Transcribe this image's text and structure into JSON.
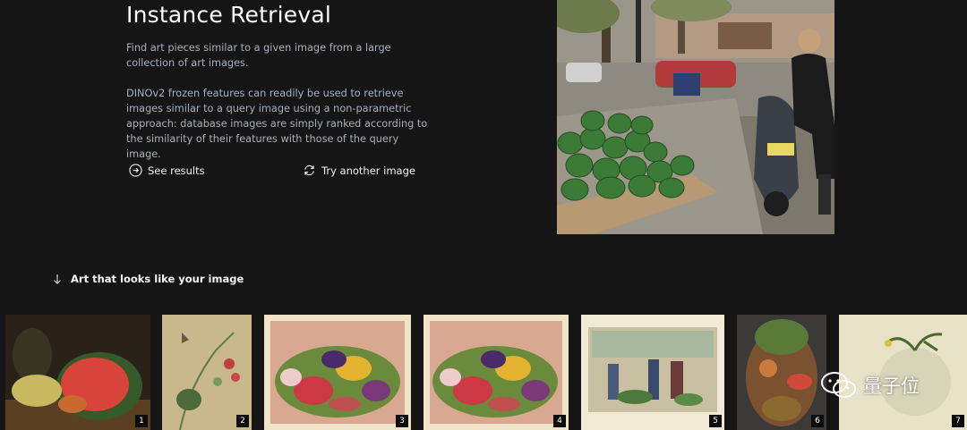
{
  "section": {
    "title": "Instance Retrieval",
    "description_1": "Find art pieces similar to a given image from a large collection of art images.",
    "description_2": "DINOv2 frozen features can readily be used to retrieve images similar to a query image using a non-parametric approach: database images are simply ranked according to the similarity of their features with those of the query image."
  },
  "actions": {
    "see_results": {
      "label": "See results",
      "icon": "arrow-right-circle-icon"
    },
    "try_another": {
      "label": "Try another image",
      "icon": "refresh-icon"
    }
  },
  "results": {
    "heading": "Art that looks like your image",
    "heading_icon": "arrow-down-icon",
    "items": [
      {
        "rank": "1"
      },
      {
        "rank": "2"
      },
      {
        "rank": "3"
      },
      {
        "rank": "4"
      },
      {
        "rank": "5"
      },
      {
        "rank": "6"
      },
      {
        "rank": "7"
      }
    ]
  },
  "watermark": {
    "text": "量子位",
    "icon": "wechat-icon"
  },
  "colors": {
    "background": "#151515",
    "text_muted": "#a9b0ba",
    "badge": "#0c0c0c"
  }
}
